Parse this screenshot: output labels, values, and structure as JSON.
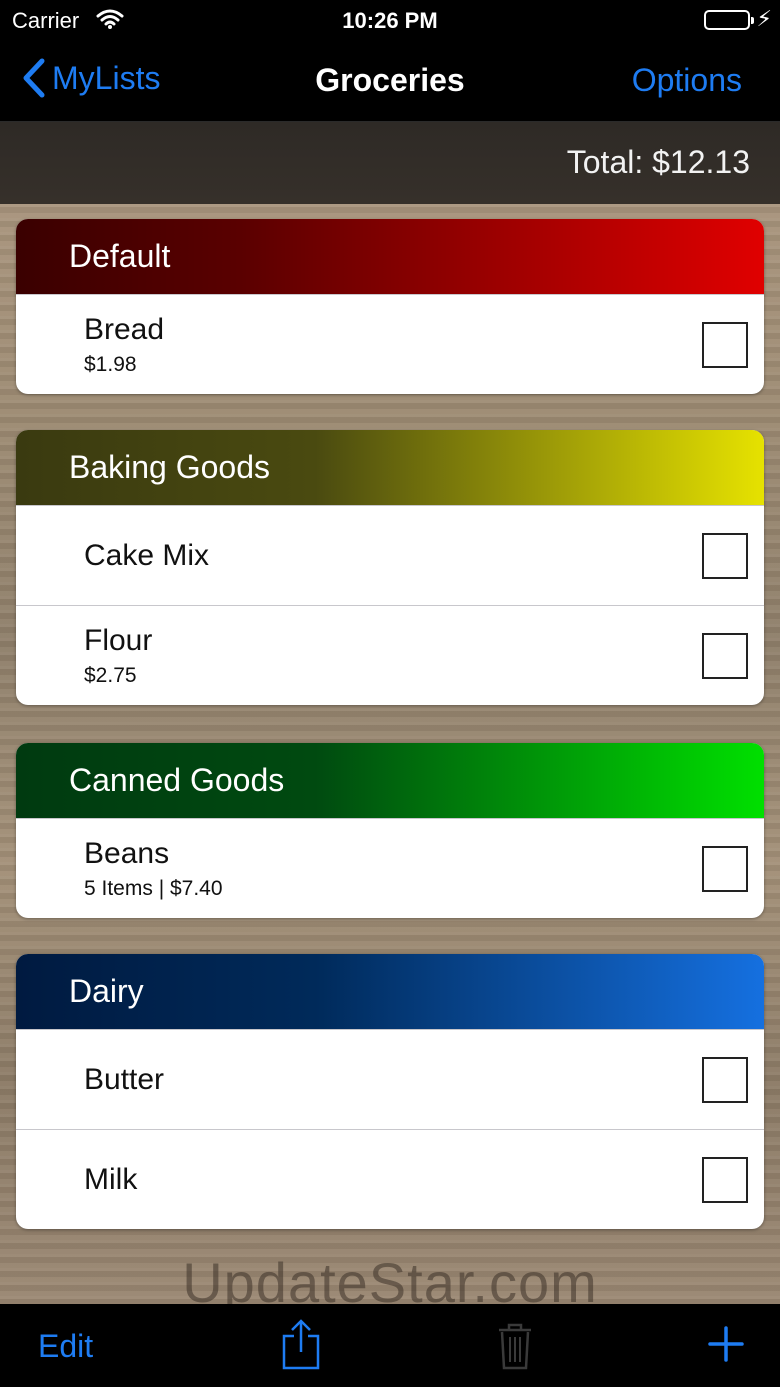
{
  "status": {
    "carrier": "Carrier",
    "time": "10:26 PM"
  },
  "nav": {
    "back_label": "MyLists",
    "title": "Groceries",
    "options_label": "Options"
  },
  "total": "Total: $12.13",
  "sections": [
    {
      "title": "Default",
      "color": "#e00000",
      "items": [
        {
          "name": "Bread",
          "sub": "$1.98"
        }
      ]
    },
    {
      "title": "Baking Goods",
      "color": "#e6e200",
      "items": [
        {
          "name": "Cake Mix"
        },
        {
          "name": "Flour",
          "sub": "$2.75"
        }
      ]
    },
    {
      "title": "Canned Goods",
      "color": "#00e000",
      "items": [
        {
          "name": "Beans",
          "sub": "5 Items | $7.40"
        }
      ]
    },
    {
      "title": "Dairy",
      "color": "#1570e0",
      "items": [
        {
          "name": "Butter"
        },
        {
          "name": "Milk"
        }
      ]
    }
  ],
  "watermark": "UpdateStar.com",
  "toolbar": {
    "edit_label": "Edit",
    "share_icon": "share-icon",
    "trash_icon": "trash-icon",
    "add_icon": "plus-icon"
  },
  "colors": {
    "accent": "#1e7cf2"
  }
}
